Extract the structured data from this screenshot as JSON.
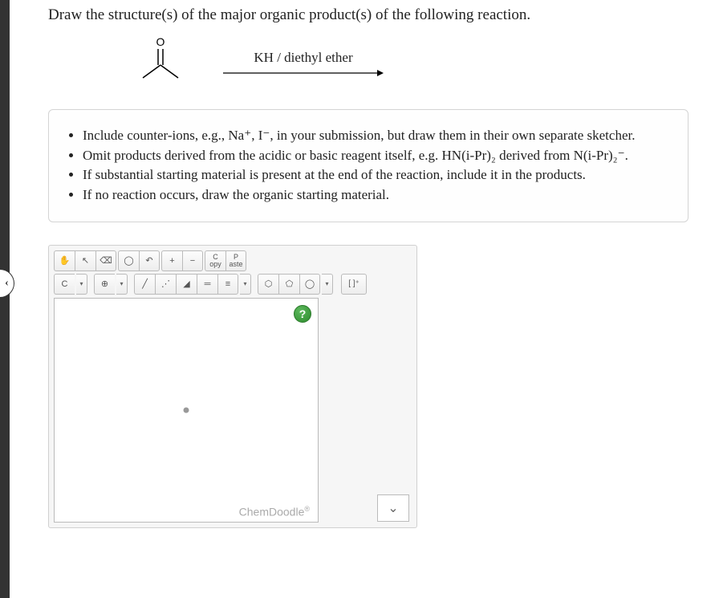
{
  "title": "Draw the structure(s) of the major organic product(s) of the following reaction.",
  "reaction": {
    "reagent": "KH / diethyl ether",
    "starting_material_label": "O"
  },
  "instructions": [
    "Include counter-ions, e.g., Na⁺, I⁻, in your submission, but draw them in their own separate sketcher.",
    "Omit products derived from the acidic or basic reagent itself, e.g. HN(i-Pr)₂ derived from N(i-Pr)₂⁻.",
    "If substantial starting material is present at the end of the reaction, include it in the products.",
    "If no reaction occurs, draw the organic starting material."
  ],
  "toolbar1": {
    "hand": "✋",
    "cursor": "↖",
    "erase": "⌫",
    "lasso": "◯",
    "undo": "↶",
    "zoom_in": "+",
    "zoom_out": "−",
    "copy_top": "C",
    "copy_bot": "opy",
    "paste_top": "P",
    "paste_bot": "aste"
  },
  "toolbar2": {
    "element": "C",
    "charge": "⊕",
    "bond1": "╱",
    "bond_dash": "⋰",
    "bond_wedge": "◢",
    "bond_double": "═",
    "bond_triple": "≡",
    "ring1": "⬡",
    "ring2": "⬠",
    "ring3": "◯",
    "bracket": "[ ]⁺"
  },
  "canvas": {
    "help": "?",
    "branding": "ChemDoodle",
    "reg": "®"
  },
  "expand_caret": "⌄",
  "left_tab": "‹"
}
